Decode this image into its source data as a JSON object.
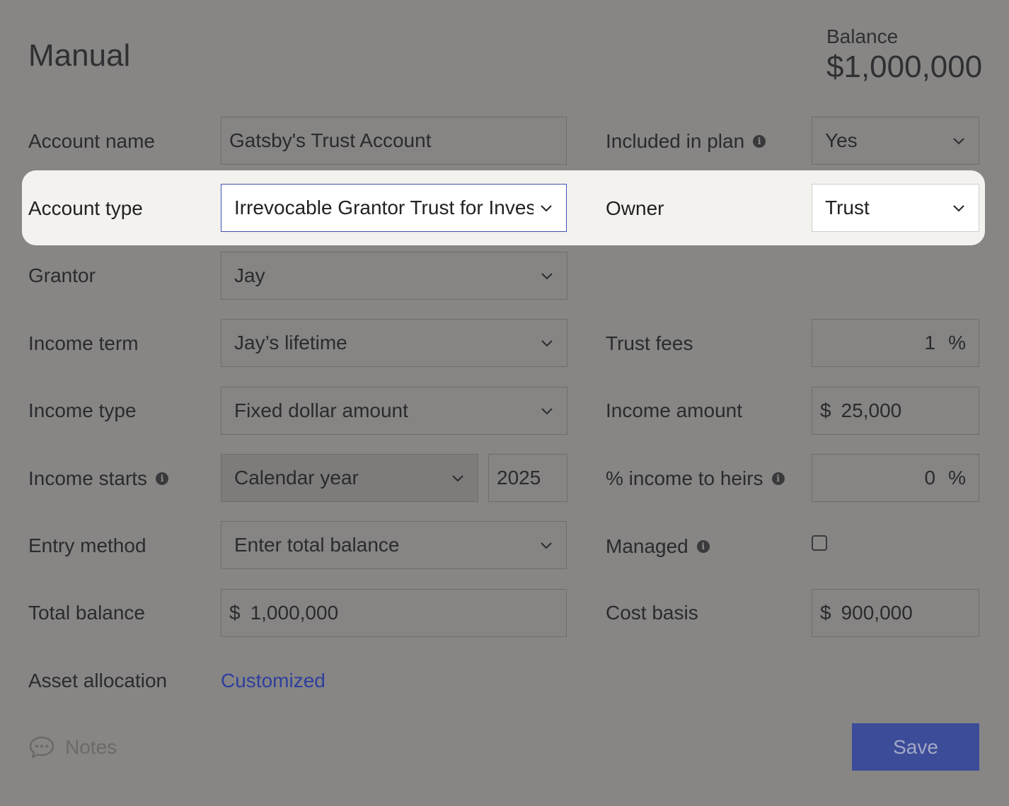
{
  "header": {
    "title": "Manual",
    "balance_label": "Balance",
    "balance_value": "$1,000,000"
  },
  "fields": {
    "account_name": {
      "label": "Account name",
      "value": "Gatsby's Trust Account"
    },
    "included_in_plan": {
      "label": "Included in plan",
      "value": "Yes"
    },
    "account_type": {
      "label": "Account type",
      "value": "Irrevocable Grantor Trust for Inves"
    },
    "owner": {
      "label": "Owner",
      "value": "Trust"
    },
    "grantor": {
      "label": "Grantor",
      "value": "Jay"
    },
    "income_term": {
      "label": "Income term",
      "value": "Jay’s lifetime"
    },
    "trust_fees": {
      "label": "Trust fees",
      "value": "1",
      "unit": "%"
    },
    "income_type": {
      "label": "Income type",
      "value": "Fixed dollar amount"
    },
    "income_amount": {
      "label": "Income amount",
      "currency": "$",
      "value": "25,000"
    },
    "income_starts": {
      "label": "Income starts",
      "value": "Calendar year",
      "year": "2025"
    },
    "income_to_heirs": {
      "label": "% income to heirs",
      "value": "0",
      "unit": "%"
    },
    "entry_method": {
      "label": "Entry method",
      "value": "Enter total balance"
    },
    "managed": {
      "label": "Managed",
      "checked": false
    },
    "total_balance": {
      "label": "Total balance",
      "currency": "$",
      "value": "1,000,000"
    },
    "cost_basis": {
      "label": "Cost basis",
      "currency": "$",
      "value": "900,000"
    },
    "asset_allocation": {
      "label": "Asset allocation",
      "value": "Customized"
    }
  },
  "footer": {
    "notes_label": "Notes",
    "save_label": "Save"
  },
  "colors": {
    "overlay": "#878685",
    "highlight": "#f3f2ee",
    "accent": "#3d4c99",
    "link": "#2e3f9c",
    "focus_border": "#3f51b5"
  }
}
